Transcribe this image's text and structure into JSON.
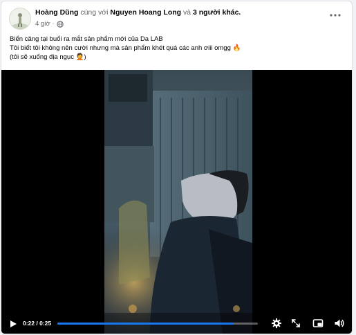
{
  "post": {
    "author": "Hoàng Dũng",
    "with_text": "cùng với",
    "tagged": "Nguyen Hoang Long",
    "and_text": "và",
    "others": "3 người khác.",
    "time": "4 giờ",
    "dot": "·",
    "caption": [
      "Biển căng tại buổi ra mắt sản phẩm mới của Da LAB",
      "Tôi biết tôi không nên cười nhưng mà sản phẩm khét quá các anh ơiii omgg 🔥",
      "(tôi sẽ xuống địa ngục 🤦)"
    ]
  },
  "icons": {
    "avatar": "avatar",
    "audience": "globe-icon",
    "more": "more-options-icon",
    "play": "play-icon",
    "settings": "gear-icon",
    "fullscreen_expand": "expand-icon",
    "pip": "picture-in-picture-icon",
    "volume": "volume-icon"
  },
  "video": {
    "time_display": "0:22 / 0:25",
    "current": "0:22",
    "duration": "0:25",
    "progress_fraction": 0.88,
    "progress_color": "#1877f2"
  }
}
